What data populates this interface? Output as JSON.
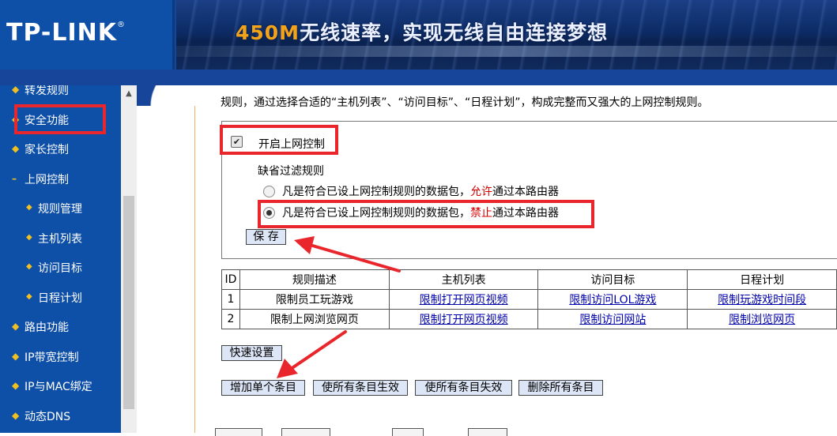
{
  "header": {
    "brand": "TP-LINK",
    "brand_mark": "®",
    "slogan_number": "450M",
    "slogan_text": "无线速率，实现无线自由连接梦想"
  },
  "sidebar": {
    "items": [
      {
        "label": "转发规则",
        "type": "group"
      },
      {
        "label": "安全功能",
        "type": "group"
      },
      {
        "label": "家长控制",
        "type": "group"
      },
      {
        "label": "上网控制",
        "type": "group-open"
      },
      {
        "label": "规则管理",
        "type": "sub",
        "active": true
      },
      {
        "label": "主机列表",
        "type": "sub"
      },
      {
        "label": "访问目标",
        "type": "sub"
      },
      {
        "label": "日程计划",
        "type": "sub"
      },
      {
        "label": "路由功能",
        "type": "group"
      },
      {
        "label": "IP带宽控制",
        "type": "group"
      },
      {
        "label": "IP与MAC绑定",
        "type": "group"
      },
      {
        "label": "动态DNS",
        "type": "group"
      }
    ]
  },
  "content": {
    "intro": "规则，通过选择合适的“主机列表”、“访问目标”、“日程计划”，构成完整而又强大的上网控制规则。",
    "enable_label": "开启上网控制",
    "enable_checked": true,
    "default_rule_label": "缺省过滤规则",
    "allow_option": {
      "prefix": "凡是符合已设上网控制规则的数据包，",
      "keyword": "允许",
      "suffix": "通过本路由器",
      "selected": false
    },
    "deny_option": {
      "prefix": "凡是符合已设上网控制规则的数据包，",
      "keyword": "禁止",
      "suffix": "通过本路由器",
      "selected": true
    },
    "save_label": "保 存",
    "table": {
      "headers": [
        "ID",
        "规则描述",
        "主机列表",
        "访问目标",
        "日程计划"
      ],
      "rows": [
        [
          "1",
          "限制员工玩游戏",
          "限制打开网页视频",
          "限制访问LOL游戏",
          "限制玩游戏时间段"
        ],
        [
          "2",
          "限制上网浏览网页",
          "限制打开网页视频",
          "限制访问网站",
          "限制浏览网页"
        ]
      ]
    },
    "quick_setup_label": "快速设置",
    "add_label": "增加单个条目",
    "enable_all_label": "使所有条目生效",
    "disable_all_label": "使所有条目失效",
    "delete_all_label": "删除所有条目"
  },
  "colors": {
    "brand_blue": "#0e4fa8",
    "highlight_red": "#e8262c",
    "keyword_red": "#d40000",
    "link_blue": "#0000aa"
  }
}
